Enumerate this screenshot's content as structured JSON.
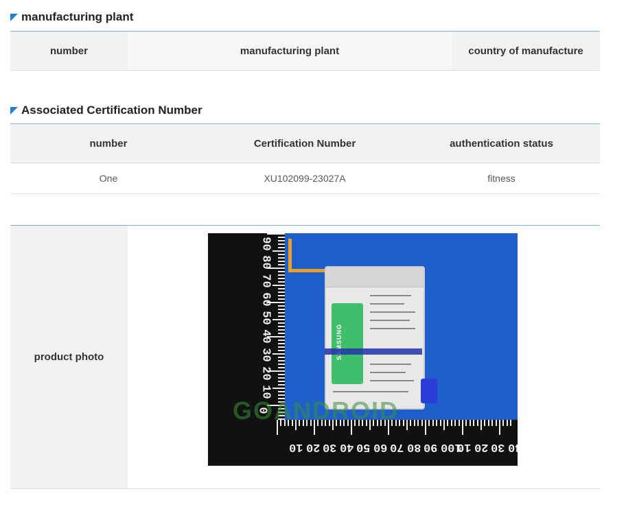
{
  "plant_section": {
    "title": "manufacturing plant",
    "headers": [
      "number",
      "manufacturing plant",
      "country of manufacture"
    ]
  },
  "cert_section": {
    "title": "Associated Certification Number",
    "headers": [
      "number",
      "Certification Number",
      "authentication status"
    ],
    "rows": [
      [
        "One",
        "XU102099-23027A",
        "fitness"
      ]
    ]
  },
  "photo_section": {
    "label": "product photo",
    "image": {
      "description_icon": "battery-photo",
      "brand_text": "SAMSUNG",
      "watermark_text": "GOANDROID",
      "ruler_unit": "mm"
    }
  },
  "colors": {
    "accent_blue": "#1f7fd6",
    "header_bg": "#f2f2f2",
    "photo_bg": "#1f5fcc"
  }
}
